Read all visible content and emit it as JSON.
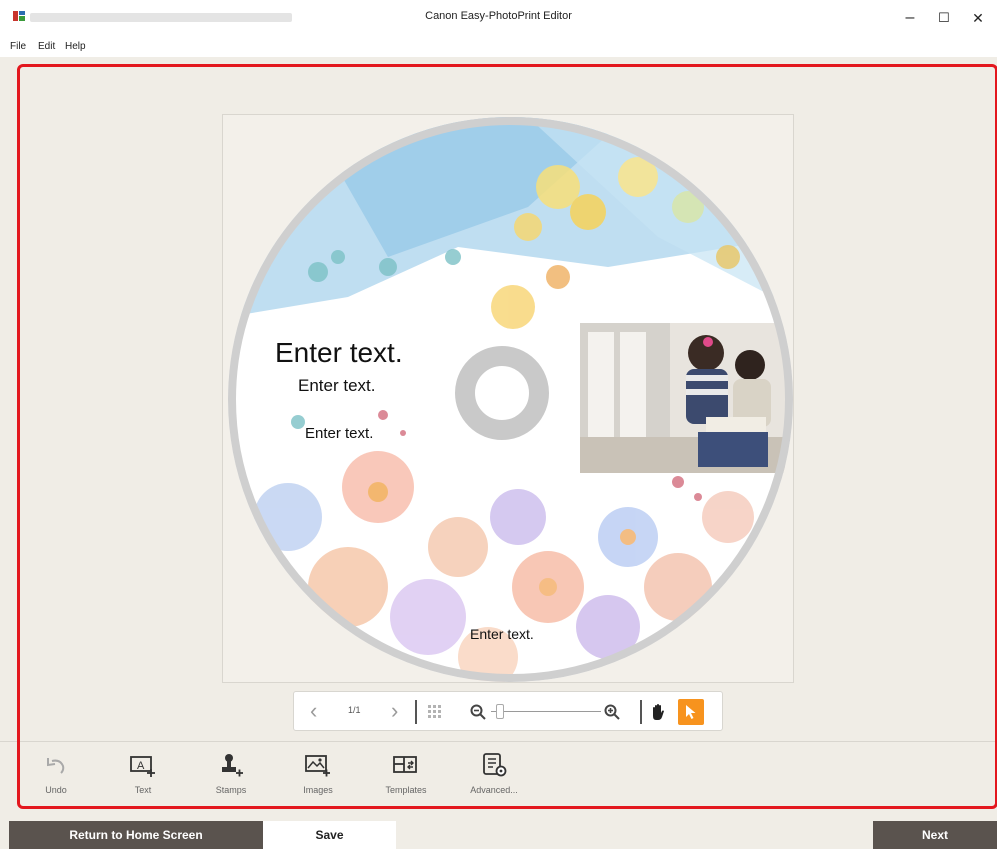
{
  "window": {
    "title": "Canon Easy-PhotoPrint Editor",
    "minimize": "–",
    "maximize": "☐",
    "close": "✕"
  },
  "menu": [
    "File",
    "Edit",
    "Help"
  ],
  "disc": {
    "texts": [
      "Enter text.",
      "Enter text.",
      "Enter text.",
      "Enter text."
    ]
  },
  "nav": {
    "prev": "‹",
    "page": "1/1",
    "next": "›",
    "zoom_level": 0.05
  },
  "toolbar": {
    "items": [
      {
        "label": "Undo",
        "icon": "undo-icon"
      },
      {
        "label": "Text",
        "icon": "text-icon"
      },
      {
        "label": "Stamps",
        "icon": "stamp-icon"
      },
      {
        "label": "Images",
        "icon": "image-icon"
      },
      {
        "label": "Templates",
        "icon": "template-icon"
      },
      {
        "label": "Advanced...",
        "icon": "advanced-icon"
      }
    ]
  },
  "bottom": {
    "home": "Return to Home Screen",
    "save": "Save",
    "next": "Next"
  },
  "colors": {
    "accent": "#f7931e",
    "highlight": "#e3171e",
    "dark_button": "#5a534e"
  }
}
